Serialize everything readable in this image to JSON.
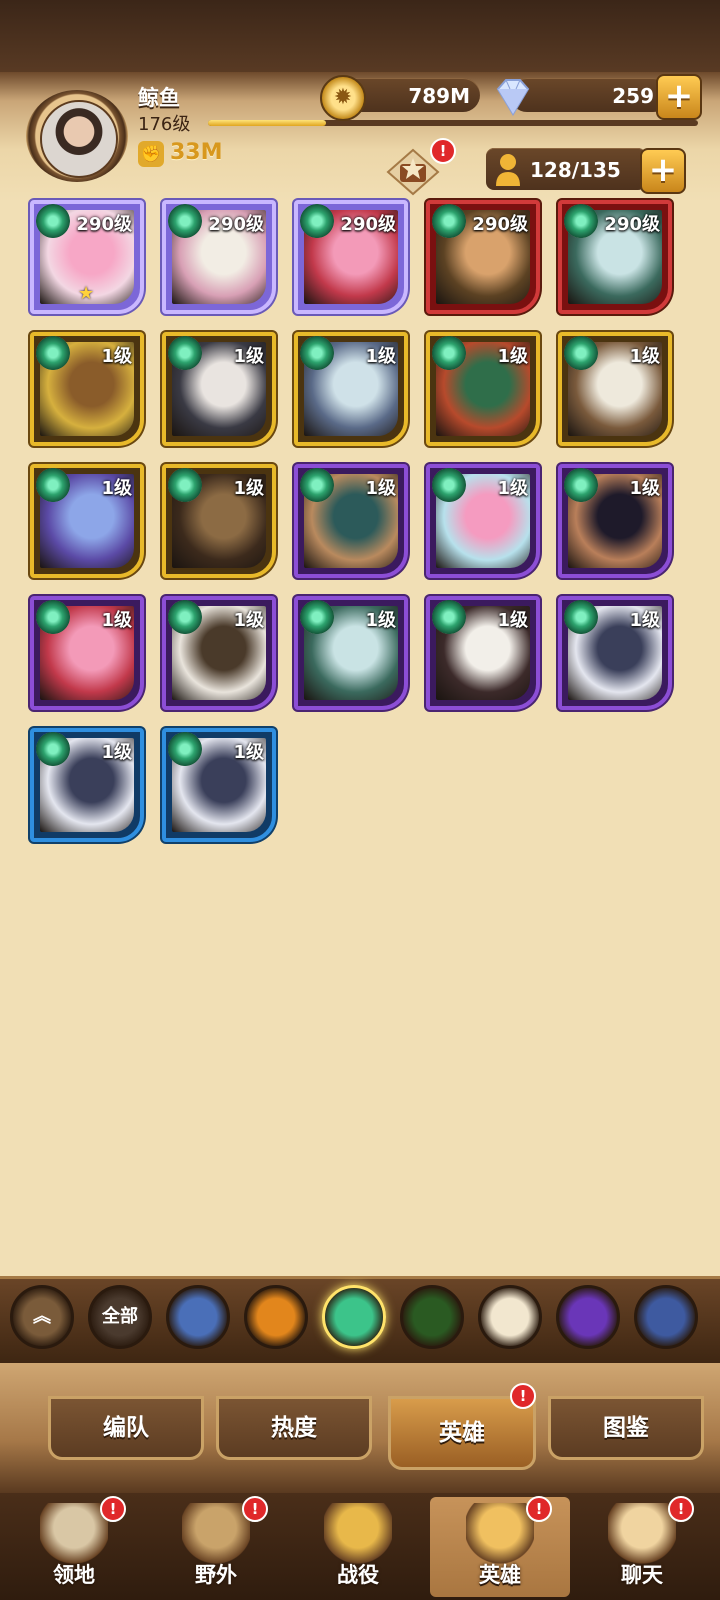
{
  "player": {
    "name": "鲸鱼",
    "level": "176级",
    "xp_progress": 0.24,
    "power": "33M"
  },
  "resources": {
    "gold": "789M",
    "diamonds": "259"
  },
  "hero_capacity": "128/135",
  "altar_badge": "!",
  "heroes": [
    {
      "level": "290级",
      "rarity": "purple-light",
      "star": "★",
      "colors": [
        "#f7a7c6",
        "#f3d7e3"
      ]
    },
    {
      "level": "290级",
      "rarity": "purple-light",
      "colors": [
        "#f2ede4",
        "#d8a0b5"
      ]
    },
    {
      "level": "290级",
      "rarity": "purple-light",
      "colors": [
        "#f39ab8",
        "#c2394b"
      ]
    },
    {
      "level": "290级",
      "rarity": "red",
      "colors": [
        "#d9a26c",
        "#5c4223"
      ]
    },
    {
      "level": "290级",
      "rarity": "red",
      "colors": [
        "#c9e3e4",
        "#3b6a5e"
      ]
    },
    {
      "level": "1级",
      "rarity": "gold",
      "colors": [
        "#8a5c2a",
        "#d6b03e"
      ]
    },
    {
      "level": "1级",
      "rarity": "gold",
      "colors": [
        "#e9e4e0",
        "#3a3a44"
      ]
    },
    {
      "level": "1级",
      "rarity": "gold",
      "colors": [
        "#cfe1e8",
        "#5a6a88"
      ]
    },
    {
      "level": "1级",
      "rarity": "gold",
      "colors": [
        "#2f6e4a",
        "#b74a2c"
      ]
    },
    {
      "level": "1级",
      "rarity": "gold",
      "colors": [
        "#eee9dc",
        "#7a5a3c"
      ]
    },
    {
      "level": "1级",
      "rarity": "gold",
      "colors": [
        "#8da6e8",
        "#5b4aa6"
      ]
    },
    {
      "level": "1级",
      "rarity": "gold",
      "colors": [
        "#8c6b44",
        "#3c2a1c"
      ]
    },
    {
      "level": "1级",
      "rarity": "purple",
      "colors": [
        "#2c5a5a",
        "#b98a5e"
      ]
    },
    {
      "level": "1级",
      "rarity": "purple",
      "colors": [
        "#f59bc0",
        "#b7e1ec"
      ]
    },
    {
      "level": "1级",
      "rarity": "purple",
      "colors": [
        "#1e1a2a",
        "#b97f5a"
      ]
    },
    {
      "level": "1级",
      "rarity": "purple",
      "colors": [
        "#f39ab8",
        "#c2394b"
      ]
    },
    {
      "level": "1级",
      "rarity": "purple",
      "colors": [
        "#4a3a2a",
        "#e9e4dc"
      ]
    },
    {
      "level": "1级",
      "rarity": "purple",
      "colors": [
        "#c9e3e4",
        "#3b6a5e"
      ]
    },
    {
      "level": "1级",
      "rarity": "purple",
      "colors": [
        "#f2efe9",
        "#3c2a2a"
      ]
    },
    {
      "level": "1级",
      "rarity": "purple",
      "colors": [
        "#3a3f5a",
        "#e4e6ef"
      ]
    },
    {
      "level": "1级",
      "rarity": "blue",
      "colors": [
        "#3a3f5a",
        "#e4e6ef"
      ]
    },
    {
      "level": "1级",
      "rarity": "blue",
      "colors": [
        "#3a3f5a",
        "#e4e6ef"
      ]
    }
  ],
  "filters": [
    {
      "name": "collapse",
      "label": "︽",
      "icon": "double-chevron-up-icon",
      "color": "#7a5b3a"
    },
    {
      "name": "all",
      "label": "全部",
      "icon": "",
      "color": "#4a3a2e"
    },
    {
      "name": "lightbearer",
      "label": "",
      "icon": "compass-star-icon",
      "color": "#4a6fb8"
    },
    {
      "name": "mauler",
      "label": "",
      "icon": "orange-emblem-icon",
      "color": "#e2861c"
    },
    {
      "name": "wilder",
      "label": "",
      "icon": "leaf-icon",
      "color": "#3cc48a",
      "selected": true
    },
    {
      "name": "graveborn",
      "label": "",
      "icon": "green-eye-icon",
      "color": "#2a5a22"
    },
    {
      "name": "celestial",
      "label": "",
      "icon": "white-star-icon",
      "color": "#f2e7cf"
    },
    {
      "name": "hypogean",
      "label": "",
      "icon": "purple-crest-icon",
      "color": "#6a36b8"
    },
    {
      "name": "dimensional",
      "label": "",
      "icon": "blue-portal-icon",
      "color": "#3e5aa0"
    }
  ],
  "tabs": [
    {
      "label": "编队",
      "active": false
    },
    {
      "label": "热度",
      "active": false
    },
    {
      "label": "英雄",
      "active": true,
      "badge": "!"
    },
    {
      "label": "图鉴",
      "active": false
    }
  ],
  "nav": [
    {
      "label": "领地",
      "icon": "castle-icon",
      "badge": "!"
    },
    {
      "label": "野外",
      "icon": "scroll-map-icon",
      "badge": "!"
    },
    {
      "label": "战役",
      "icon": "battle-crest-icon"
    },
    {
      "label": "英雄",
      "icon": "helmet-icon",
      "badge": "!",
      "active": true
    },
    {
      "label": "聊天",
      "icon": "chat-bubble-icon",
      "badge": "!"
    }
  ]
}
